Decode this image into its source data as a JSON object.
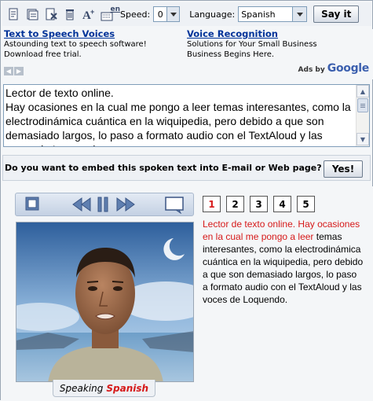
{
  "toolbar": {
    "icons": [
      "new-document-icon",
      "open-file-icon",
      "clear-text-icon",
      "delete-icon",
      "font-size-icon",
      "dictionary-icon"
    ],
    "dictionary_badge": "en",
    "speed_label": "Speed:",
    "speed_value": "0",
    "language_label": "Language:",
    "language_value": "Spanish",
    "sayit_label": "Say it"
  },
  "ads": [
    {
      "title": "Text to Speech Voices",
      "line1": "Astounding text to speech software!",
      "line2": "Download free trial."
    },
    {
      "title": "Voice Recognition",
      "line1": "Solutions for Your Small Business",
      "line2": "Business Begins Here."
    }
  ],
  "ads_by": {
    "label": "Ads by",
    "brand": "Google"
  },
  "text_input": {
    "value": "Lector de texto online.\nHay ocasiones en la cual me pongo a leer temas interesantes, como la electrodinámica cuántica en la wiquipedia, pero debido a que son demasiado largos, lo paso a formato audio con el TextAloud y las voces de Loquendo."
  },
  "embed": {
    "question": "Do you want to embed this spoken text into E-mail or Web page?",
    "yes_label": "Yes!"
  },
  "player": {
    "pages": [
      "1",
      "2",
      "3",
      "4",
      "5"
    ],
    "active_page": "1",
    "speaking_label": "Speaking",
    "speaking_language": "Spanish",
    "spoken_text": "Lector de texto online. Hay ocasiones en la cual me pongo a leer",
    "remaining_text": "temas interesantes, como la electrodinámica cuántica en la wiquipedia, pero debido a que son demasiado largos, lo paso a formato audio con el TextAloud y las voces de Loquendo."
  },
  "colors": {
    "link": "#003399",
    "highlight": "#d61a1a",
    "panel": "#eef1f5"
  }
}
